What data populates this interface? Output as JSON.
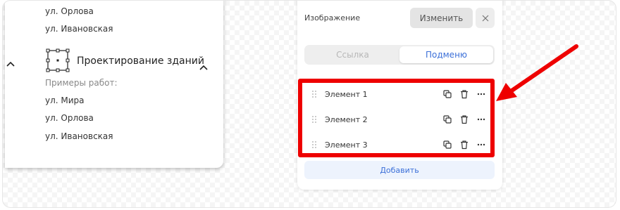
{
  "menu": {
    "top_streets": [
      "ул. Орлова",
      "ул. Ивановская"
    ],
    "service_title": "Проектирование зданий",
    "examples_label": "Примеры работ:",
    "streets": [
      "ул. Мира",
      "ул. Орлова",
      "ул. Ивановская"
    ]
  },
  "panel": {
    "image_label": "Изображение",
    "change_label": "Изменить",
    "tabs": [
      {
        "label": "Ссылка",
        "active": false
      },
      {
        "label": "Подменю",
        "active": true
      }
    ],
    "items": [
      {
        "label": "Элемент 1"
      },
      {
        "label": "Элемент 2"
      },
      {
        "label": "Элемент 3"
      }
    ],
    "add_label": "Добавить"
  },
  "colors": {
    "accent": "#3b6fd8",
    "annotation": "#ee0000"
  },
  "icons": [
    "chevron-up-icon",
    "close-icon",
    "drag-handle-icon",
    "copy-icon",
    "trash-icon",
    "more-icon",
    "service-frame-icon"
  ]
}
